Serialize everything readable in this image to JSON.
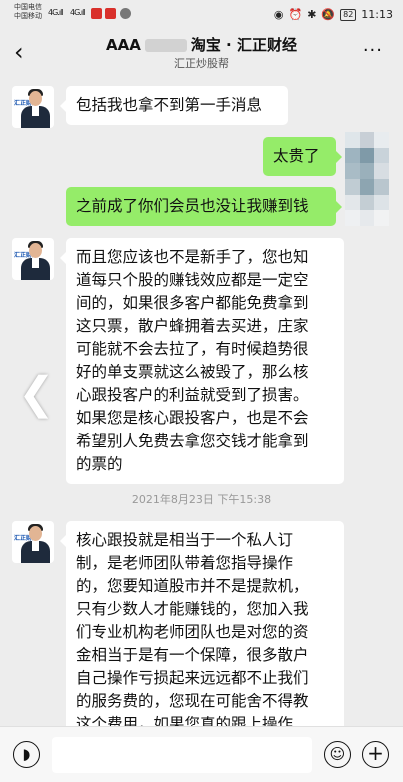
{
  "status_bar": {
    "carrier_1": "中国电信",
    "carrier_2": "中国移动",
    "signal_1": "4G",
    "signal_2": "4G",
    "battery": "82",
    "time": "11:13"
  },
  "header": {
    "title_start": "AAA",
    "title_mid": "淘宝",
    "title_end": "汇正财经",
    "subtitle": "汇正炒股帮",
    "back_icon": "chevron-left-icon",
    "more_label": "···"
  },
  "avatar": {
    "logo_text": "汇正财经"
  },
  "messages": [
    {
      "side": "left",
      "text": "包括我也拿不到第一手消息"
    },
    {
      "side": "right",
      "text": "太贵了"
    },
    {
      "side": "right",
      "text": "之前成了你们会员也没让我赚到钱"
    },
    {
      "side": "left",
      "lines": [
        "而且您应该也不是新手了，您也知",
        "道每只个股的赚钱效应都是一定空",
        "间的，如果很多客户都能免费拿到",
        "这只票，散户蜂拥着去买进，庄家",
        "可能就不会去拉了，有时候趋势很",
        "好的单支票就这么被毁了，那么核",
        "心跟投客户的利益就受到了损害。",
        "如果您是核心跟投客户，也是不会",
        "希望别人免费去拿您交钱才能拿到",
        "的票的"
      ]
    },
    {
      "side": "left",
      "lines": [
        "核心跟投就是相当于一个私人订",
        "制，是老师团队带着您指导操作",
        "的，您要知道股市并不是提款机，",
        "只有少数人才能赚钱的，您加入我",
        "们专业机构老师团队也是对您的资",
        "金相当于是有一个保障，很多散户",
        "自己操作亏损起来远远都不止我们",
        "的服务费的，您现在可能舍不得教",
        "这个费用，如果您真的跟上操作"
      ]
    }
  ],
  "timestamp": "2021年8月23日 下午15:38",
  "input_bar": {
    "voice_icon": "voice-icon",
    "emoji_icon": "emoji-icon",
    "add_icon": "plus-icon"
  },
  "colors": {
    "bubble_right": "#95ec69",
    "bubble_left": "#ffffff",
    "background": "#ededed"
  }
}
